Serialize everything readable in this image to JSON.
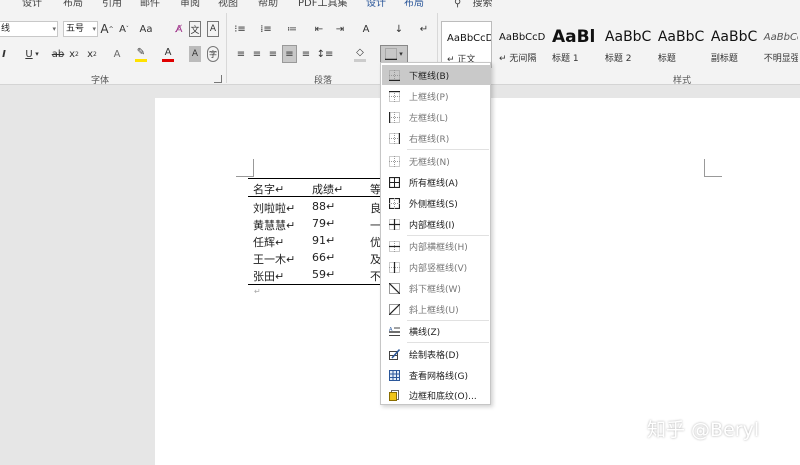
{
  "ribbon_tabs": [
    "设计",
    "布局",
    "引用",
    "邮件",
    "审阅",
    "视图",
    "帮助",
    "PDF工具集",
    "设计",
    "布局"
  ],
  "search_label": "搜索",
  "font": {
    "name": "线",
    "size": "五号"
  },
  "group_labels": {
    "font": "字体",
    "paragraph": "段落",
    "styles": "样式"
  },
  "styles_gallery": [
    {
      "preview": "AaBbCcD",
      "name": "↵ 正文"
    },
    {
      "preview": "AaBbCcD",
      "name": "↵ 无间隔"
    },
    {
      "preview": "AaBl",
      "name": "标题 1"
    },
    {
      "preview": "AaBbC",
      "name": "标题 2"
    },
    {
      "preview": "AaBbC",
      "name": "标题"
    },
    {
      "preview": "AaBbC",
      "name": "副标题"
    },
    {
      "preview": "AaBbCcD",
      "name": "不明显强"
    }
  ],
  "table": {
    "headers": [
      "名字↵",
      "成绩↵",
      "等"
    ],
    "rows": [
      [
        "刘啦啦↵",
        "88↵",
        "良"
      ],
      [
        "黄慧慧↵",
        "79↵",
        "一"
      ],
      [
        "任辉↵",
        "91↵",
        "优"
      ],
      [
        "王一木↵",
        "66↵",
        "及"
      ],
      [
        "张田↵",
        "59↵",
        "不"
      ]
    ],
    "after_mark": "↵"
  },
  "border_menu": [
    {
      "label": "下框线(B)",
      "icon": "bottom-border-icon"
    },
    {
      "label": "上框线(P)",
      "icon": "top-border-icon"
    },
    {
      "label": "左框线(L)",
      "icon": "left-border-icon"
    },
    {
      "label": "右框线(R)",
      "icon": "right-border-icon"
    },
    {
      "label": "无框线(N)",
      "icon": "no-border-icon"
    },
    {
      "label": "所有框线(A)",
      "icon": "all-borders-icon"
    },
    {
      "label": "外侧框线(S)",
      "icon": "outside-borders-icon"
    },
    {
      "label": "内部框线(I)",
      "icon": "inside-borders-icon"
    },
    {
      "label": "内部横框线(H)",
      "icon": "inside-horizontal-border-icon"
    },
    {
      "label": "内部竖框线(V)",
      "icon": "inside-vertical-border-icon"
    },
    {
      "label": "斜下框线(W)",
      "icon": "diagonal-down-border-icon"
    },
    {
      "label": "斜上框线(U)",
      "icon": "diagonal-up-border-icon"
    },
    {
      "label": "横线(Z)",
      "icon": "horizontal-line-icon"
    },
    {
      "label": "绘制表格(D)",
      "icon": "draw-table-icon"
    },
    {
      "label": "查看网格线(G)",
      "icon": "view-gridlines-icon"
    },
    {
      "label": "边框和底纹(O)...",
      "icon": "borders-shading-icon"
    }
  ],
  "watermark": "知乎 @Beryl"
}
